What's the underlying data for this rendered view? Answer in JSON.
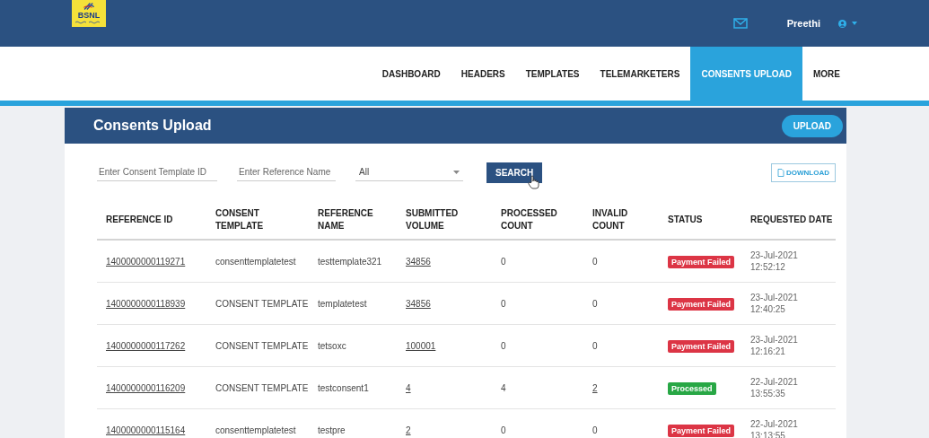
{
  "brand": {
    "logo_text": "BSNL"
  },
  "user": {
    "name": "Preethi"
  },
  "nav": [
    {
      "label": "DASHBOARD",
      "selected": false
    },
    {
      "label": "HEADERS",
      "selected": false
    },
    {
      "label": "TEMPLATES",
      "selected": false
    },
    {
      "label": "TELEMARKETERS",
      "selected": false
    },
    {
      "label": "CONSENTS UPLOAD",
      "selected": true
    },
    {
      "label": "MORE",
      "selected": false
    }
  ],
  "card": {
    "title": "Consents Upload",
    "upload_button": "UPLOAD"
  },
  "filters": {
    "template_id": {
      "placeholder": "Enter Consent Template ID"
    },
    "reference_name": {
      "placeholder": "Enter Reference Name"
    },
    "status_select": {
      "value": "All"
    },
    "search_button": "SEARCH",
    "download_button": "DOWNLOAD"
  },
  "table": {
    "columns": [
      [
        "REFERENCE ID"
      ],
      [
        "CONSENT",
        "TEMPLATE"
      ],
      [
        "REFERENCE",
        "NAME"
      ],
      [
        "SUBMITTED",
        "VOLUME"
      ],
      [
        "PROCESSED",
        "COUNT"
      ],
      [
        "INVALID",
        "COUNT"
      ],
      [
        "STATUS"
      ],
      [
        "REQUESTED DATE"
      ]
    ],
    "rows": [
      {
        "reference_id": "1400000000119271",
        "consent_template": "consenttemplatetest",
        "reference_name": "testtemplate321",
        "submitted_volume": "34856",
        "processed_count": "0",
        "invalid_count": "0",
        "invalid_linked": false,
        "status": {
          "text": "Payment Failed",
          "color": "#dc3545"
        },
        "date": "23-Jul-2021",
        "time": "12:52:12"
      },
      {
        "reference_id": "1400000000118939",
        "consent_template": "CONSENT TEMPLATE",
        "reference_name": "templatetest",
        "submitted_volume": "34856",
        "processed_count": "0",
        "invalid_count": "0",
        "invalid_linked": false,
        "status": {
          "text": "Payment Failed",
          "color": "#dc3545"
        },
        "date": "23-Jul-2021",
        "time": "12:40:25"
      },
      {
        "reference_id": "1400000000117262",
        "consent_template": "CONSENT TEMPLATE",
        "reference_name": "tetsoxc",
        "submitted_volume": "100001",
        "processed_count": "0",
        "invalid_count": "0",
        "invalid_linked": false,
        "status": {
          "text": "Payment Failed",
          "color": "#dc3545"
        },
        "date": "23-Jul-2021",
        "time": "12:16:21"
      },
      {
        "reference_id": "1400000000116209",
        "consent_template": "CONSENT TEMPLATE",
        "reference_name": "testconsent1",
        "submitted_volume": "4",
        "processed_count": "4",
        "invalid_count": "2",
        "invalid_linked": true,
        "status": {
          "text": "Processed",
          "color": "#28a745"
        },
        "date": "22-Jul-2021",
        "time": "13:55:35"
      },
      {
        "reference_id": "1400000000115164",
        "consent_template": "consenttemplatetest",
        "reference_name": "testpre",
        "submitted_volume": "2",
        "processed_count": "0",
        "invalid_count": "0",
        "invalid_linked": false,
        "status": {
          "text": "Payment Failed",
          "color": "#dc3545"
        },
        "date": "22-Jul-2021",
        "time": "13:13:55"
      }
    ]
  }
}
